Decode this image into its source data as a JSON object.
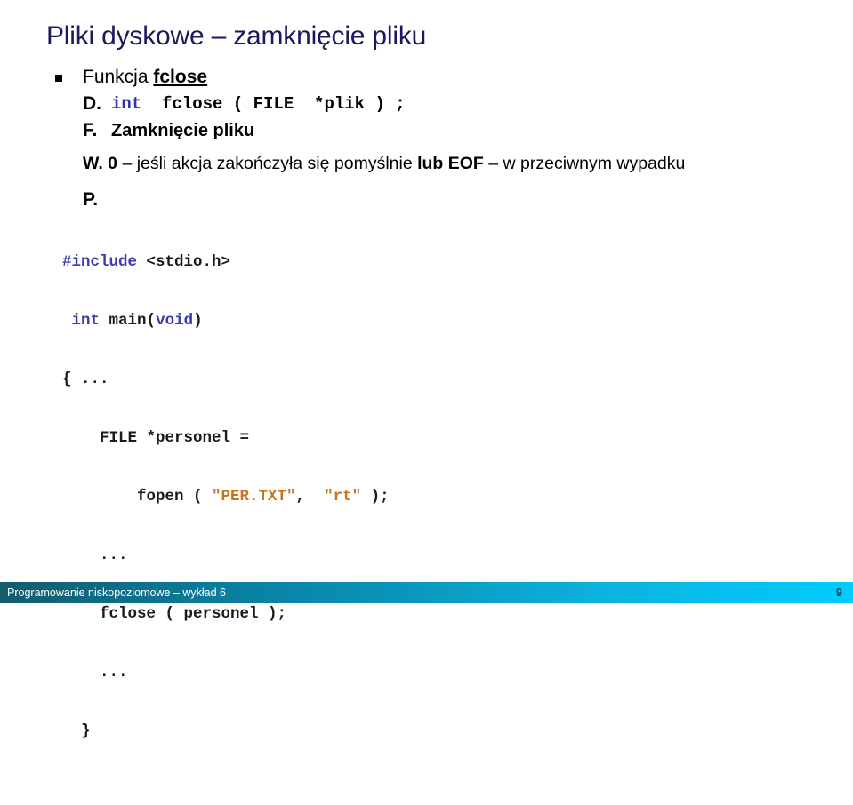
{
  "slide": {
    "title": "Pliki dyskowe – zamknięcie pliku",
    "bullet": {
      "prefix": "Funkcja ",
      "keyword": "fclose"
    },
    "rows": {
      "declaration": {
        "label": "D.",
        "code_type": "int",
        "code_rest": "  fclose ( FILE  *plik ) ;"
      },
      "function": {
        "label": "F.",
        "text": "Zamknięcie pliku"
      },
      "value": {
        "label": "W.",
        "part1_bold": "0",
        "part2": " – jeśli akcja zakończyła się pomyślnie ",
        "part3_bold": "lub EOF",
        "part4": " – w przeciwnym wypadku"
      },
      "example": {
        "label": "P."
      }
    },
    "code": {
      "line1_pre": "#include",
      "line1_rest": " <stdio.h>",
      "line2_kw1": "int",
      "line2_name": " main",
      "line2_paren_open": "(",
      "line2_kw2": "void",
      "line2_paren_close": ")",
      "line3": "{ ...",
      "line4": "    FILE *personel =",
      "line5_call": "        fopen ( ",
      "line5_str1": "\"PER.TXT\"",
      "line5_mid": ",  ",
      "line5_str2": "\"rt\"",
      "line5_end": " );",
      "line6": "    ...",
      "line7": "    fclose ( personel );",
      "line8": "    ...",
      "line9": "  }"
    }
  },
  "footer": {
    "text": "Programowanie niskopoziomowe – wykład 6",
    "page": "9"
  },
  "colors": {
    "title": "#1a1a5e",
    "keyword_blue": "#3a3aae",
    "string_orange": "#c4751f",
    "footer_gradient_start": "#125c6e",
    "footer_gradient_end": "#00ccff",
    "footer_page": "#0d4e63"
  }
}
